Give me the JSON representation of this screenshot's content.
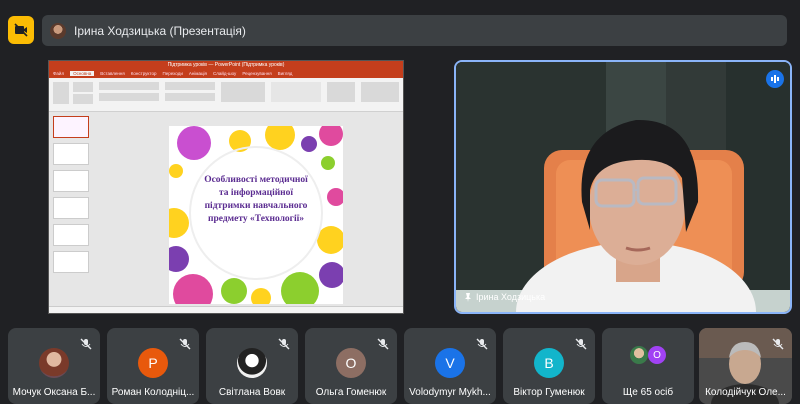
{
  "header": {
    "presenter_title": "Ірина Ходзицька (Презентація)",
    "camera_icon": "camera-off-icon",
    "accent_color": "#fbbc04"
  },
  "presentation": {
    "window_title": "Підтримка уроків — PowerPoint (Підтримка уроків)",
    "tabs": [
      "Файл",
      "Основна",
      "Вставлення",
      "Конструктор",
      "Переходи",
      "Анімація",
      "Слайд-шоу",
      "Рецензування",
      "Вигляд"
    ],
    "slide_text": "Особливості методичної та інформаційної підтримки навчального предмету «Технології»",
    "text_color": "#5b2c91"
  },
  "main_video": {
    "name": "Ірина Ходзицька",
    "border_color": "#8ab4f8"
  },
  "participants": [
    {
      "name": "Мочук Оксана Б...",
      "initial": "",
      "avatar_color": "#8a6a5a",
      "muted": true
    },
    {
      "name": "Роман Колодніц...",
      "initial": "Р",
      "avatar_color": "#e8590c",
      "muted": true
    },
    {
      "name": "Світлана Вовк",
      "initial": "",
      "avatar_color": "#f1f1f1",
      "muted": true
    },
    {
      "name": "Ольга Гоменюк",
      "initial": "О",
      "avatar_color": "#8d6e63",
      "muted": true
    },
    {
      "name": "Volodymyr Mykh...",
      "initial": "V",
      "avatar_color": "#1a73e8",
      "muted": true
    },
    {
      "name": "Віктор Гуменюк",
      "initial": "В",
      "avatar_color": "#12b5cb",
      "muted": true
    },
    {
      "name": "Ще 65 осіб",
      "initial": "О",
      "avatar_color": "#a142f4",
      "muted": false
    },
    {
      "name": "Колодійчук Оле...",
      "initial": "",
      "avatar_color": "#555",
      "muted": true
    }
  ]
}
